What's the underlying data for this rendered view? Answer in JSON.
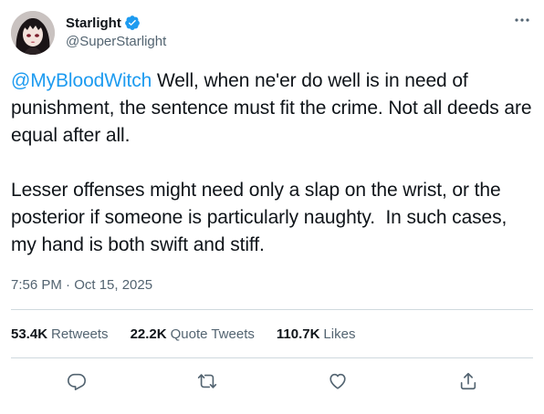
{
  "author": {
    "display_name": "Starlight",
    "handle": "@SuperStarlight",
    "avatar_icon": "anime-portrait-avatar",
    "verified": true,
    "verified_color": "#1d9bf0"
  },
  "tweet": {
    "mention": "@MyBloodWitch",
    "text_after_mention": " Well, when ne'er do well is in need of punishment, the sentence must fit the crime. Not all deeds are equal after all.\n\nLesser offenses might need only a slap on the wrist, or the posterior if someone is particularly naughty.  In such cases, my hand is both swift and stiff.",
    "timestamp": "7:56 PM · Oct 15, 2025"
  },
  "stats": {
    "retweets_count": "53.4K",
    "retweets_label": "Retweets",
    "quotes_count": "22.2K",
    "quotes_label": "Quote Tweets",
    "likes_count": "110.7K",
    "likes_label": "Likes"
  },
  "actions": {
    "reply_icon": "reply-icon",
    "retweet_icon": "retweet-icon",
    "like_icon": "heart-icon",
    "share_icon": "share-icon"
  },
  "colors": {
    "accent": "#1d9bf0",
    "text_primary": "#0f1419",
    "text_secondary": "#536471",
    "divider": "#cfd9de"
  }
}
